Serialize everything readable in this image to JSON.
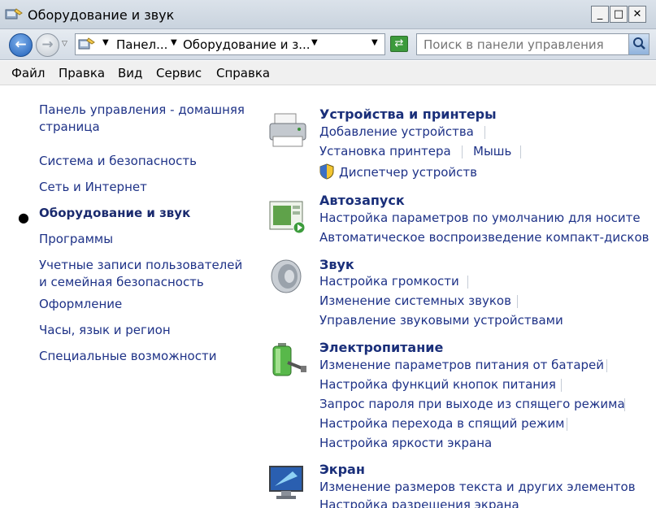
{
  "window": {
    "title": "Оборудование и звук",
    "buttons": {
      "minimize": "_",
      "maximize": "□",
      "close": "✕"
    }
  },
  "address": {
    "crumbs": [
      "Панел...",
      "Оборудование и з..."
    ],
    "search_placeholder": "Поиск в панели управления"
  },
  "menu": [
    "Файл",
    "Правка",
    "Вид",
    "Сервис",
    "Справка"
  ],
  "nav": {
    "home": "Панель управления - домашняя страница",
    "home_line1": "Панель управления - домашняя",
    "home_line2": "страница",
    "items": [
      "Система и безопасность",
      "Сеть и Интернет",
      "Оборудование и звук",
      "Программы",
      "Учетные записи пользователей",
      "и семейная безопасность",
      "Оформление",
      "Часы, язык и регион",
      "Специальные возможности"
    ]
  },
  "categories": {
    "devices": {
      "title": "Устройства и принтеры",
      "links": [
        "Добавление устройства",
        "Установка принтера",
        "Мышь",
        "Диспетчер устройств"
      ]
    },
    "autoplay": {
      "title": "Автозапуск",
      "links": [
        "Настройка параметров по умолчанию для носите",
        "Автоматическое воспроизведение компакт-дисков"
      ]
    },
    "sound": {
      "title": "Звук",
      "links": [
        "Настройка громкости",
        "Изменение системных звуков",
        "Управление звуковыми устройствами"
      ]
    },
    "power": {
      "title": "Электропитание",
      "links": [
        "Изменение параметров питания от батарей",
        "Настройка функций кнопок питания",
        "Запрос пароля при выходе из спящего режима",
        "Настройка перехода в спящий режим",
        "Настройка яркости экрана"
      ]
    },
    "display": {
      "title": "Экран",
      "links": [
        "Изменение размеров текста и других элементов",
        "Настройка разрешения экрана"
      ]
    }
  }
}
